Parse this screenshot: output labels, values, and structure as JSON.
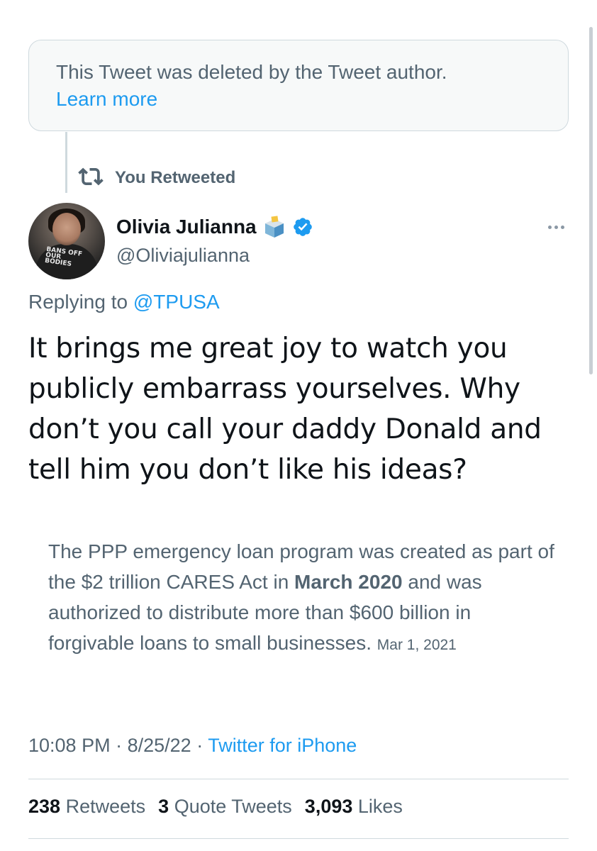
{
  "deleted_notice": {
    "text": "This Tweet was deleted by the Tweet author.",
    "learn_more": "Learn more"
  },
  "retweet_banner": {
    "icon": "retweet-icon",
    "label": "You Retweeted"
  },
  "author": {
    "name": "Olivia Julianna",
    "handle": "@Oliviajulianna",
    "avatar_shirt_text": "BANS OFF OUR BODIES",
    "badges": [
      "ballot-box-icon",
      "verified-icon"
    ]
  },
  "reply_context": {
    "prefix": "Replying to",
    "mention": "@TPUSA"
  },
  "tweet": {
    "text": "It brings me great joy to watch you publicly embarrass yourselves. Why don’t you call your daddy Donald and tell him you don’t like his ideas?"
  },
  "quoted_snippet": {
    "part1": "The PPP emergency loan program was created as part of the $2 trillion CARES Act in ",
    "bold": "March 2020",
    "part2": " and was authorized to distribute more than $600 billion in forgivable loans to small businesses.",
    "date": "Mar 1, 2021"
  },
  "meta": {
    "time": "10:08 PM",
    "separator": "·",
    "date": "8/25/22",
    "source": "Twitter for iPhone"
  },
  "stats": {
    "retweets_count": "238",
    "retweets_label": "Retweets",
    "quotes_count": "3",
    "quotes_label": "Quote Tweets",
    "likes_count": "3,093",
    "likes_label": "Likes"
  },
  "colors": {
    "accent": "#1d9bf0",
    "secondary_text": "#536471",
    "primary_text": "#0f1419",
    "border": "#cfd9de"
  }
}
